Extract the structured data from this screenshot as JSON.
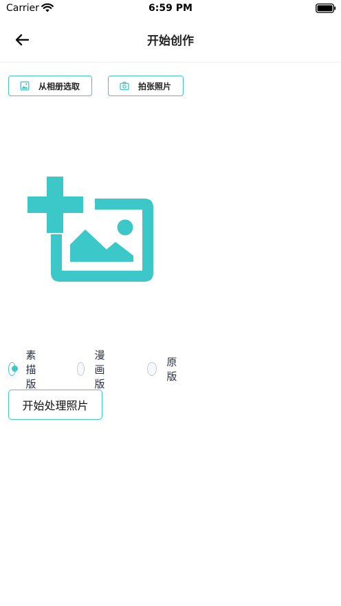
{
  "status_bar": {
    "carrier": "Carrier",
    "time": "6:59 PM"
  },
  "nav": {
    "title": "开始创作",
    "back_icon": "arrow-left-icon"
  },
  "actions": {
    "album_label": "从相册选取",
    "album_icon": "image-icon",
    "camera_label": "拍张照片",
    "camera_icon": "camera-icon"
  },
  "placeholder": {
    "icon": "add-photo-icon"
  },
  "modes": {
    "options": [
      {
        "label": "素描版",
        "selected": true
      },
      {
        "label": "漫画版",
        "selected": false
      },
      {
        "label": "原版",
        "selected": false
      }
    ]
  },
  "start_button": {
    "label": "开始处理照片"
  },
  "colors": {
    "accent": "#3cc8c8",
    "radio_border": "#c4c8d4",
    "text": "#222222"
  }
}
